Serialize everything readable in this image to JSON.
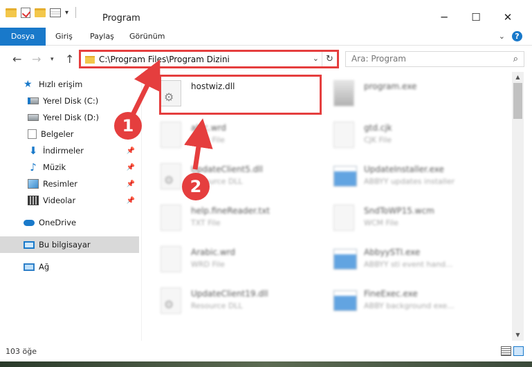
{
  "window": {
    "title": "Program"
  },
  "ribbon": {
    "tabs": [
      "Dosya",
      "Giriş",
      "Paylaş",
      "Görünüm"
    ],
    "help": "?"
  },
  "address": {
    "path": "C:\\Program Files\\Program Dizini"
  },
  "search": {
    "placeholder": "Ara: Program"
  },
  "sidebar": {
    "items": [
      {
        "label": "Hızlı erişim"
      },
      {
        "label": "Yerel Disk (C:)"
      },
      {
        "label": "Yerel Disk (D:)"
      },
      {
        "label": "Belgeler"
      },
      {
        "label": "İndirmeler"
      },
      {
        "label": "Müzik"
      },
      {
        "label": "Resimler"
      },
      {
        "label": "Videolar"
      },
      {
        "label": "OneDrive"
      },
      {
        "label": "Bu bilgisayar"
      },
      {
        "label": "Ağ"
      }
    ]
  },
  "files": [
    {
      "name": "hostwiz.dll",
      "type": ""
    },
    {
      "name": "program.exe",
      "type": ""
    },
    {
      "name": "abic.wrd",
      "type": "WRD File"
    },
    {
      "name": "gtd.cjk",
      "type": "CJK File"
    },
    {
      "name": "UpdateClient5.dll",
      "type": "Resource DLL"
    },
    {
      "name": "UpdateInstaller.exe",
      "type": "ABBYY updates installer"
    },
    {
      "name": "help.fineReader.txt",
      "type": "TXT File"
    },
    {
      "name": "SndToWP15.wcm",
      "type": "WCM File"
    },
    {
      "name": "Arabic.wrd",
      "type": "WRD File"
    },
    {
      "name": "AbbyySTI.exe",
      "type": "ABBYY sti event hand..."
    },
    {
      "name": "UpdateClient19.dll",
      "type": "Resource DLL"
    },
    {
      "name": "FineExec.exe",
      "type": "ABBY background exe..."
    }
  ],
  "status": {
    "count": "103 öğe"
  },
  "callouts": [
    "1",
    "2"
  ],
  "colors": {
    "accent": "#1979ca",
    "highlight": "#e53e3e"
  }
}
